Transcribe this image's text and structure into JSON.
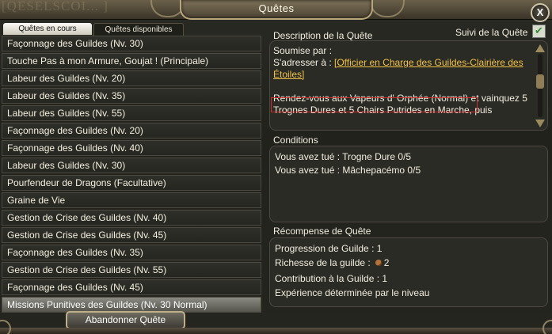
{
  "window": {
    "title": "Quêtes",
    "background_text": "[QESELSCOI... ]"
  },
  "tabs": [
    {
      "label": "Quêtes en cours",
      "active": true
    },
    {
      "label": "Quêtes disponibles",
      "active": false
    }
  ],
  "quests": [
    "Façonnage des Guildes (Nv. 30)",
    "Touche Pas à mon Armure, Goujat ! (Principale)",
    "Labeur des Guildes (Nv. 20)",
    "Labeur des Guildes (Nv. 35)",
    "Labeur des Guildes (Nv. 55)",
    "Façonnage des Guildes (Nv. 20)",
    "Façonnage des Guildes (Nv. 40)",
    "Labeur des Guildes (Nv. 30)",
    "Pourfendeur de Dragons (Facultative)",
    "Graine de Vie",
    "Gestion de Crise des Guildes (Nv. 40)",
    "Gestion de Crise des Guildes (Nv. 45)",
    "Façonnage des Guildes (Nv. 35)",
    "Gestion de Crise des Guildes (Nv. 55)",
    "Façonnage des Guildes (Nv. 45)",
    "Missions Punitives des Guildes (Nv. 30 Normal)"
  ],
  "selected_quest_index": 15,
  "description": {
    "title": "Description de la Quête",
    "track_label": "Suivi de la Quête",
    "track_checked": true,
    "submitted_by": "Soumise par :",
    "contact_prefix": "S'adresser à :",
    "contact_link": "[Officier en Charge des Guildes-Clairière des Étoiles]",
    "body_highlight": "Rendez-vous aux Vapeurs d' Orphée (Normal)",
    "body_rest": " et vainquez 5 Trognes Dures et 5 Chairs Putrides en Marche, puis"
  },
  "conditions": {
    "title": "Conditions",
    "items": [
      "Vous avez tué : Trogne Dure 0/5",
      "Vous avez tué : Mâchepacémo 0/5"
    ]
  },
  "rewards": {
    "title": "Récompense de Quête",
    "guild_progress": "Progression de Guilde : 1",
    "guild_wealth_label": "Richesse de la guilde :",
    "guild_wealth_value": "2",
    "guild_contribution": "Contribution à la Guilde : 1",
    "experience": "Expérience déterminée par le niveau"
  },
  "buttons": {
    "abandon": "Abandonner Quête",
    "close": "X"
  },
  "colors": {
    "link": "#f0c045",
    "highlight_border": "#cf2d2d",
    "checkmark": "#3c8a3c"
  }
}
